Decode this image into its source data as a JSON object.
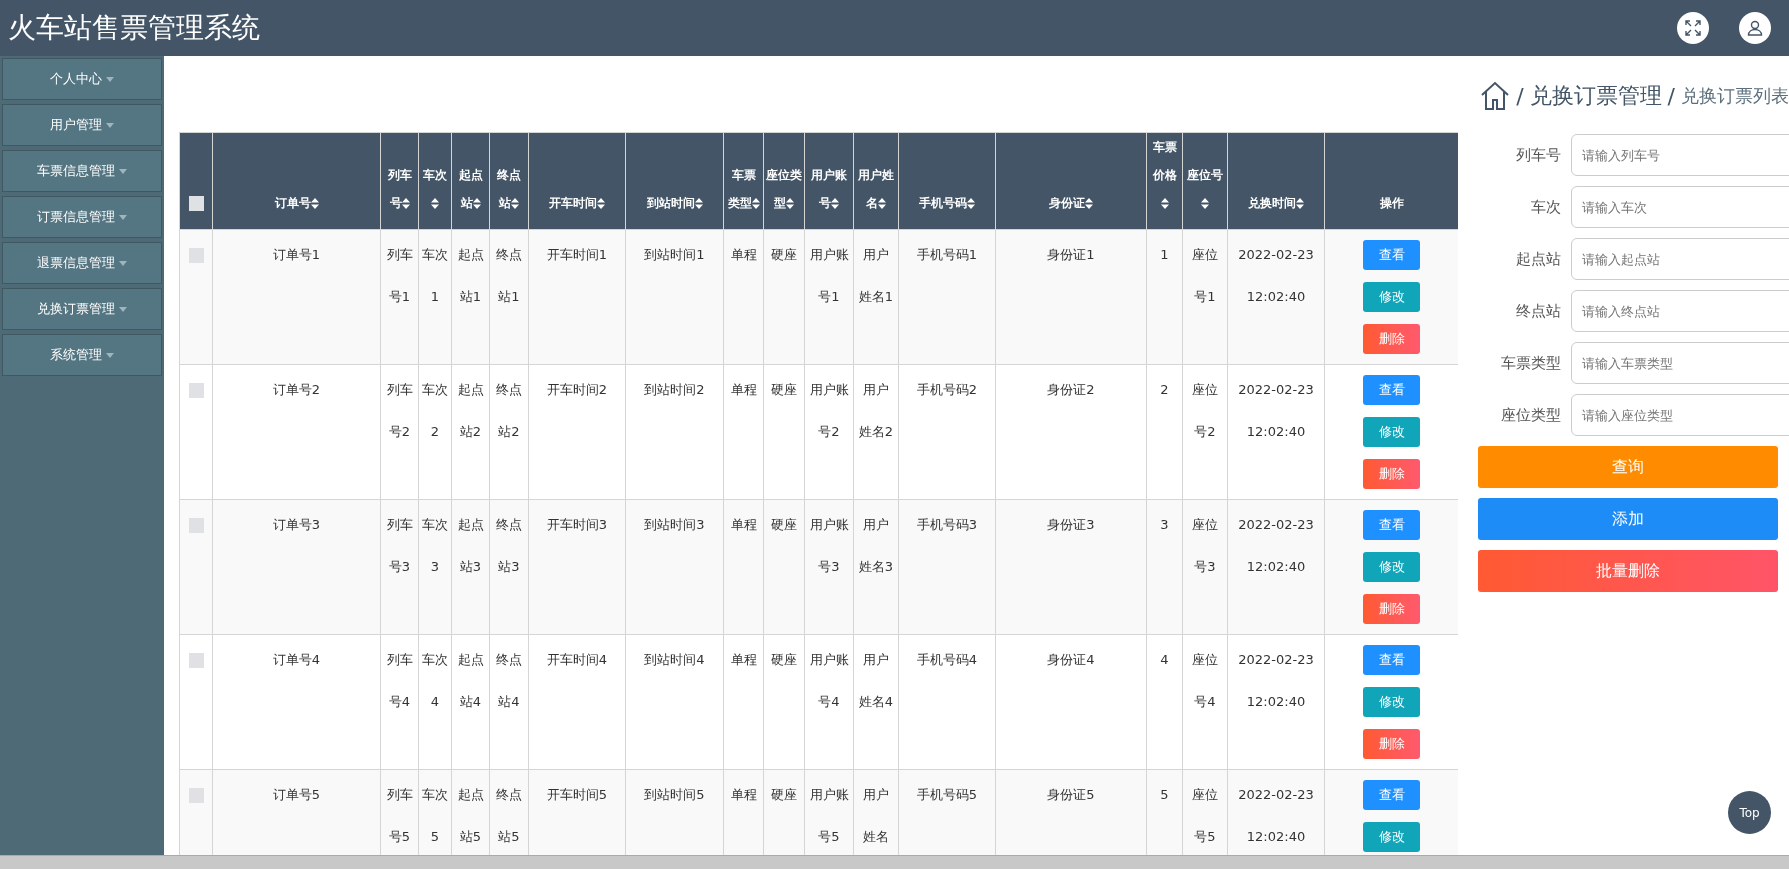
{
  "header": {
    "title": "火车站售票管理系统"
  },
  "sidebar": {
    "items": [
      {
        "label": "个人中心"
      },
      {
        "label": "用户管理"
      },
      {
        "label": "车票信息管理"
      },
      {
        "label": "订票信息管理"
      },
      {
        "label": "退票信息管理"
      },
      {
        "label": "兑换订票管理"
      },
      {
        "label": "系统管理"
      }
    ]
  },
  "breadcrumb": {
    "separators": [
      "/",
      "/"
    ],
    "section": "兑换订票管理",
    "page": "兑换订票列表"
  },
  "table": {
    "select_all": {
      "checked": false
    },
    "columns": [
      {
        "label": "订单号",
        "sortable": true
      },
      {
        "label": "列车号",
        "sortable": true
      },
      {
        "label": "车次",
        "sortable": true
      },
      {
        "label": "起点站",
        "sortable": true
      },
      {
        "label": "终点站",
        "sortable": true
      },
      {
        "label": "开车时间",
        "sortable": true
      },
      {
        "label": "到站时间",
        "sortable": true
      },
      {
        "label": "车票类型",
        "sortable": true
      },
      {
        "label": "座位类型",
        "sortable": true
      },
      {
        "label": "用户账号",
        "sortable": true
      },
      {
        "label": "用户姓名",
        "sortable": true
      },
      {
        "label": "手机号码",
        "sortable": true
      },
      {
        "label": "身份证",
        "sortable": true
      },
      {
        "label": "车票价格",
        "sortable": true
      },
      {
        "label": "座位号",
        "sortable": true
      },
      {
        "label": "兑换时间",
        "sortable": true
      },
      {
        "label": "操作",
        "sortable": false
      }
    ],
    "rows": [
      {
        "checked": false,
        "cells": [
          "订单号1",
          "列车号1",
          "车次1",
          "起点站1",
          "终点站1",
          "开车时间1",
          "到站时间1",
          "单程",
          "硬座",
          "用户账号1",
          "用户姓名1",
          "手机号码1",
          "身份证1",
          "1",
          "座位号1",
          "2022-02-23 12:02:40"
        ],
        "actions": [
          {
            "label": "查看",
            "kind": "view"
          },
          {
            "label": "修改",
            "kind": "edit"
          },
          {
            "label": "删除",
            "kind": "delete"
          }
        ]
      },
      {
        "checked": false,
        "cells": [
          "订单号2",
          "列车号2",
          "车次2",
          "起点站2",
          "终点站2",
          "开车时间2",
          "到站时间2",
          "单程",
          "硬座",
          "用户账号2",
          "用户姓名2",
          "手机号码2",
          "身份证2",
          "2",
          "座位号2",
          "2022-02-23 12:02:40"
        ],
        "actions": [
          {
            "label": "查看",
            "kind": "view"
          },
          {
            "label": "修改",
            "kind": "edit"
          },
          {
            "label": "删除",
            "kind": "delete"
          }
        ]
      },
      {
        "checked": false,
        "cells": [
          "订单号3",
          "列车号3",
          "车次3",
          "起点站3",
          "终点站3",
          "开车时间3",
          "到站时间3",
          "单程",
          "硬座",
          "用户账号3",
          "用户姓名3",
          "手机号码3",
          "身份证3",
          "3",
          "座位号3",
          "2022-02-23 12:02:40"
        ],
        "actions": [
          {
            "label": "查看",
            "kind": "view"
          },
          {
            "label": "修改",
            "kind": "edit"
          },
          {
            "label": "删除",
            "kind": "delete"
          }
        ]
      },
      {
        "checked": false,
        "cells": [
          "订单号4",
          "列车号4",
          "车次4",
          "起点站4",
          "终点站4",
          "开车时间4",
          "到站时间4",
          "单程",
          "硬座",
          "用户账号4",
          "用户姓名4",
          "手机号码4",
          "身份证4",
          "4",
          "座位号4",
          "2022-02-23 12:02:40"
        ],
        "actions": [
          {
            "label": "查看",
            "kind": "view"
          },
          {
            "label": "修改",
            "kind": "edit"
          },
          {
            "label": "删除",
            "kind": "delete"
          }
        ]
      },
      {
        "checked": false,
        "cells": [
          "订单号5",
          "列车号5",
          "车次5",
          "起点站5",
          "终点站5",
          "开车时间5",
          "到站时间5",
          "单程",
          "硬座",
          "用户账号5",
          "用户姓名",
          "手机号码5",
          "身份证5",
          "5",
          "座位号5",
          "2022-02-23 12:02:40"
        ],
        "actions": [
          {
            "label": "查看",
            "kind": "view"
          },
          {
            "label": "修改",
            "kind": "edit"
          }
        ]
      }
    ]
  },
  "search": {
    "fields": [
      {
        "label": "列车号",
        "placeholder": "请输入列车号"
      },
      {
        "label": "车次",
        "placeholder": "请输入车次"
      },
      {
        "label": "起点站",
        "placeholder": "请输入起点站"
      },
      {
        "label": "终点站",
        "placeholder": "请输入终点站"
      },
      {
        "label": "车票类型",
        "placeholder": "请输入车票类型"
      },
      {
        "label": "座位类型",
        "placeholder": "请输入座位类型"
      }
    ],
    "buttons": [
      {
        "label": "查询",
        "kind": "query"
      },
      {
        "label": "添加",
        "kind": "add"
      },
      {
        "label": "批量删除",
        "kind": "delete"
      }
    ]
  },
  "back_to_top": {
    "label": "Top"
  }
}
